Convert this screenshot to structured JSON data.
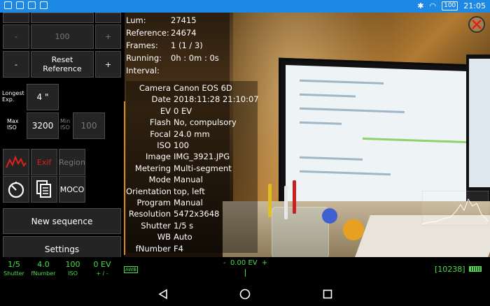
{
  "status_bar": {
    "time": "21:05",
    "battery": "100"
  },
  "controls": {
    "top_left_label": "-",
    "top_value": "100",
    "top_right_label": "+",
    "minus_label": "-",
    "reset_label": "Reset\nReference",
    "plus_label": "+",
    "longest_exp_label": "Longest\nExp.",
    "longest_exp_value": "4 \"",
    "max_iso_label": "Max\nISO",
    "max_iso_value": "3200",
    "min_iso_label": "Min\nISO",
    "min_iso_value": "100",
    "exif_label": "Exif",
    "region_label": "Region",
    "moco_label": "MOCO",
    "new_sequence_label": "New sequence",
    "settings_label": "Settings"
  },
  "info": [
    {
      "key": "Lum:",
      "value": "27415"
    },
    {
      "key": "Reference:",
      "value": "24674"
    },
    {
      "key": "Frames:",
      "value": "1 (1 / 3)"
    },
    {
      "key": "Running:",
      "value": "0h : 0m : 0s"
    },
    {
      "key": "Interval:",
      "value": ""
    }
  ],
  "exif": [
    {
      "key": "Camera",
      "value": "Canon EOS 6D"
    },
    {
      "key": "Date",
      "value": "2018:11:28 21:10:07"
    },
    {
      "key": "EV",
      "value": "0 EV"
    },
    {
      "key": "Flash",
      "value": "No, compulsory"
    },
    {
      "key": "Focal",
      "value": "24.0 mm"
    },
    {
      "key": "ISO",
      "value": "100"
    },
    {
      "key": "Image",
      "value": "IMG_3921.JPG"
    },
    {
      "key": "Metering",
      "value": "Multi-segment"
    },
    {
      "key": "Mode",
      "value": "Manual"
    },
    {
      "key": "Orientation",
      "value": "top, left"
    },
    {
      "key": "Program",
      "value": "Manual"
    },
    {
      "key": "Resolution",
      "value": "5472x3648"
    },
    {
      "key": "Shutter",
      "value": "1/5 s"
    },
    {
      "key": "WB",
      "value": "Auto"
    },
    {
      "key": "fNumber",
      "value": "F4"
    }
  ],
  "bottom": {
    "shutter_value": "1/5",
    "shutter_label": "Shutter",
    "fnumber_value": "4.0",
    "fnumber_label": "fNumber",
    "iso_value": "100",
    "iso_label": "ISO",
    "ev_value": "0 EV",
    "ev_label": "+ / -",
    "awb": "AWB",
    "ev_scale": "-  0.00 EV  +",
    "count": "[10238]"
  },
  "colors": {
    "accent_green": "#4cdc4c",
    "status_blue": "#1e88e5",
    "orange_line": "#d58a1c"
  }
}
